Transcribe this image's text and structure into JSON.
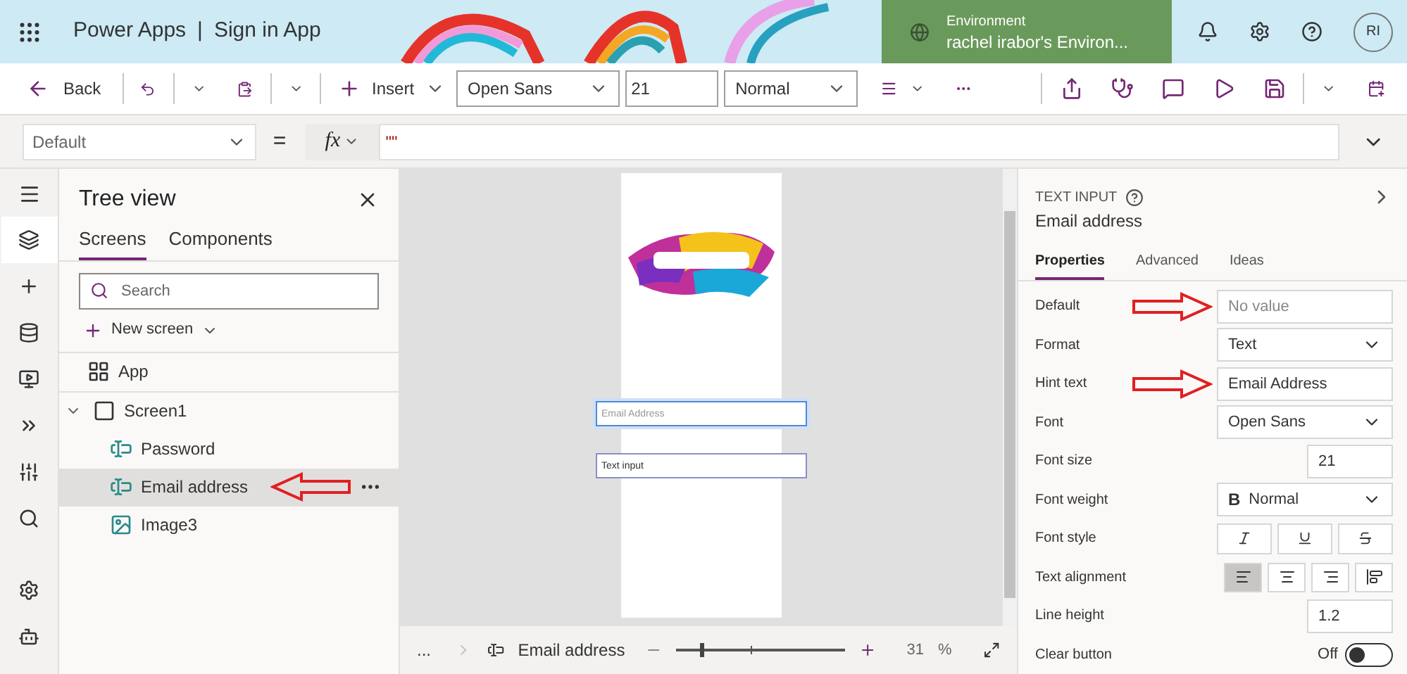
{
  "header": {
    "app_name": "Power Apps",
    "separator": "|",
    "app_title": "Sign in App",
    "environment": {
      "label": "Environment",
      "name": "rachel irabor's Environ..."
    },
    "avatar": "RI"
  },
  "toolbar": {
    "back": "Back",
    "insert": "Insert",
    "font": "Open Sans",
    "font_size": "21",
    "font_weight": "Normal"
  },
  "formula_bar": {
    "property": "Default",
    "equals": "=",
    "fx": "fx",
    "formula": "\"\""
  },
  "rail": [
    {
      "kind": "tree",
      "selected": true
    },
    {
      "kind": "insert",
      "selected": false
    },
    {
      "kind": "data",
      "selected": false
    },
    {
      "kind": "media",
      "selected": false
    },
    {
      "kind": "automate",
      "selected": false
    },
    {
      "kind": "tools",
      "selected": false
    },
    {
      "kind": "search",
      "selected": false
    },
    {
      "kind": "settings",
      "selected": false
    },
    {
      "kind": "bot",
      "selected": false
    }
  ],
  "tree_view": {
    "title": "Tree view",
    "tabs": [
      {
        "label": "Screens",
        "selected": true
      },
      {
        "label": "Components",
        "selected": false
      }
    ],
    "search": {
      "placeholder": "Search"
    },
    "new_screen": "New screen",
    "items": [
      {
        "kind": "app",
        "label": "App",
        "selected": false
      },
      {
        "kind": "screen",
        "label": "Screen1",
        "selected": false,
        "expanded": true,
        "children": [
          {
            "kind": "text_input",
            "label": "Password",
            "selected": false
          },
          {
            "kind": "text_input",
            "label": "Email address",
            "selected": true
          },
          {
            "kind": "image",
            "label": "Image3",
            "selected": false
          }
        ]
      }
    ]
  },
  "canvas": {
    "inputs": [
      {
        "placeholder": "Email Address",
        "selected": true
      },
      {
        "value": "Text input",
        "selected": false
      }
    ],
    "status_bar": {
      "more": "...",
      "control": "Email address",
      "zoom": {
        "level": 0.15
      },
      "zoom_value": "31",
      "zoom_unit": "%"
    }
  },
  "properties": {
    "type": "TEXT INPUT",
    "name": "Email address",
    "tabs": [
      {
        "label": "Properties",
        "selected": true
      },
      {
        "label": "Advanced",
        "selected": false
      },
      {
        "label": "Ideas",
        "selected": false
      }
    ],
    "rows": [
      {
        "kind": "text",
        "label": "Default",
        "placeholder": "No value",
        "annotated": true
      },
      {
        "kind": "dropdown",
        "label": "Format",
        "value": "Text",
        "annotated": false
      },
      {
        "kind": "text",
        "label": "Hint text",
        "value": "Email Address",
        "annotated": true
      },
      {
        "kind": "dropdown",
        "label": "Font",
        "value": "Open Sans",
        "annotated": false
      },
      {
        "kind": "number",
        "label": "Font size",
        "value": "21",
        "annotated": false
      },
      {
        "kind": "dropdown",
        "label": "Font weight",
        "prefix": "B",
        "value": "Normal",
        "annotated": false
      },
      {
        "kind": "styles",
        "label": "Font style",
        "annotated": false,
        "options": [
          {
            "kind": "italic",
            "selected": false
          },
          {
            "kind": "underline",
            "selected": false
          },
          {
            "kind": "strike",
            "selected": false
          }
        ]
      },
      {
        "kind": "align",
        "label": "Text alignment",
        "annotated": false,
        "options": [
          {
            "kind": "left",
            "selected": true
          },
          {
            "kind": "center",
            "selected": false
          },
          {
            "kind": "right",
            "selected": false
          },
          {
            "kind": "top",
            "selected": false
          }
        ]
      },
      {
        "kind": "number",
        "label": "Line height",
        "value": "1.2",
        "annotated": false
      },
      {
        "kind": "toggle",
        "label": "Clear button",
        "value": "Off",
        "on": false,
        "annotated": false
      }
    ]
  }
}
